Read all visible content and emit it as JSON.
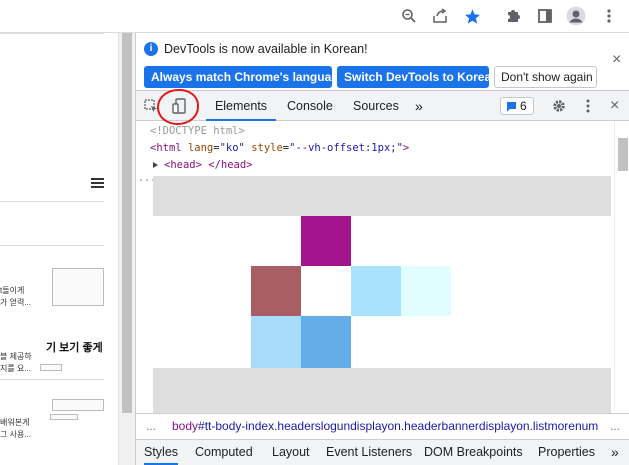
{
  "toolbar": {
    "icons": [
      "zoom-icon",
      "share-icon",
      "star-icon",
      "extensions-icon",
      "side-panel-icon",
      "profile-icon",
      "more-menu-icon"
    ],
    "star_color": "#1a73e8"
  },
  "page_left": {
    "snippets": [
      {
        "text": "t돌이게"
      },
      {
        "text": "가 얻력..."
      },
      {
        "text": "블 제공하"
      },
      {
        "text": "지를 요..."
      },
      {
        "text": "배워본게"
      },
      {
        "text": "그 사용..."
      }
    ],
    "heading": "기 보기 좋게",
    "hamburger_icon": "hamburger-icon"
  },
  "devtools": {
    "info": {
      "message": "DevTools is now available in Korean!",
      "btn_match": "Always match Chrome's language",
      "btn_switch": "Switch DevTools to Korean",
      "btn_dismiss": "Don't show again",
      "close": "×"
    },
    "tabs": {
      "elements": "Elements",
      "console": "Console",
      "sources": "Sources",
      "more": "»",
      "issues_count": "6"
    },
    "code": {
      "doctype": "<!DOCTYPE html>",
      "html_open_tag": "<html",
      "html_attr_lang": "lang",
      "html_val_lang": "\"ko\"",
      "html_attr_style": "style",
      "html_val_style": "\"--vh-offset:1px;\"",
      "html_close": ">",
      "head_line": "<head> </head>",
      "ellipsis": "..."
    },
    "breadcrumb": {
      "dots": "...",
      "tag": "body",
      "selector": "#tt-body-index.headerslogundisplayon.headerbannerdisplayon.listmorenum",
      "more": "..."
    },
    "subtabs": [
      "Styles",
      "Computed",
      "Layout",
      "Event Listeners",
      "DOM Breakpoints",
      "Properties",
      "»"
    ]
  },
  "colors": {
    "accent": "#1a73e8",
    "annotation_red": "#e01818",
    "overlay_gray": "#dedede",
    "block_purple": "#a4148f",
    "block_rose": "#a85e64",
    "block_lightblue": "#a8e3fb",
    "block_paleblue": "#e2fdff",
    "block_skyblue": "#a9dcfb",
    "block_blue": "#65ade8"
  }
}
